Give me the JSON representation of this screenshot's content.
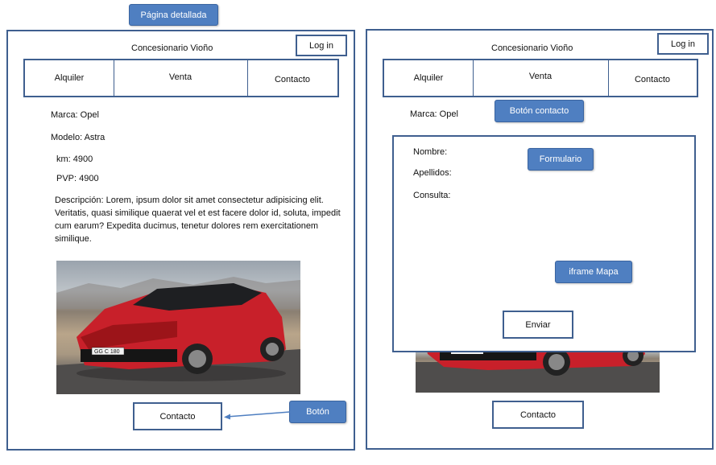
{
  "annotations": {
    "detailed_page": "Página detallada",
    "button": "Botón",
    "contact_button": "Botón  contacto",
    "form": "Formulario",
    "iframe_map": "iframe Mapa"
  },
  "left_page": {
    "brand": "Concesionario Vioño",
    "login": "Log in",
    "nav": [
      "Alquiler",
      "Venta",
      "Contacto"
    ],
    "marca": "Marca: Opel",
    "modelo": "Modelo: Astra",
    "km": "km: 4900",
    "pvp": "PVP: 4900",
    "descripcion": "Descripción: Lorem, ipsum dolor sit amet consectetur adipisicing elit. Veritatis, quasi similique quaerat vel et est facere dolor id, soluta, impedit cum earum? Expedita ducimus, tenetur dolores rem exercitationem similique.",
    "car_plate": "GG C 180",
    "contact_button": "Contacto"
  },
  "right_page": {
    "brand": "Concesionario Vioño",
    "login": "Log in",
    "nav": [
      "Alquiler",
      "Venta",
      "Contacto"
    ],
    "marca": "Marca: Opel",
    "form": {
      "nombre": "Nombre:",
      "apellidos": "Apellidos:",
      "consulta": "Consulta:",
      "submit": "Enviar"
    },
    "contact_button": "Contacto"
  },
  "colors": {
    "frame_border": "#3f5f8f",
    "note_fill": "#4f7fc1",
    "car_body": "#c8202a"
  }
}
